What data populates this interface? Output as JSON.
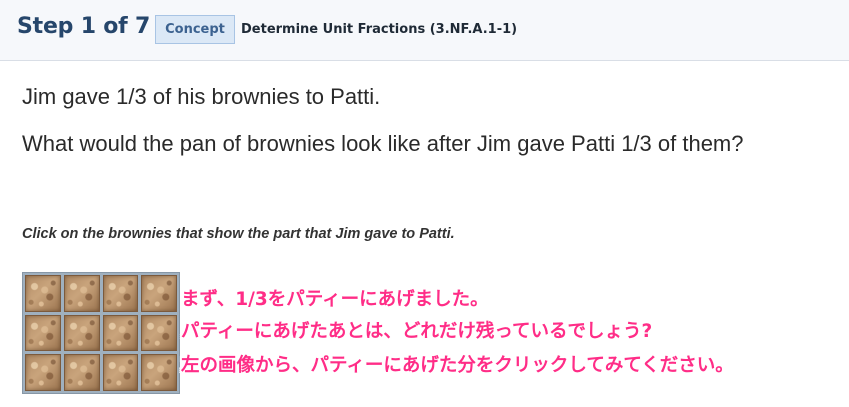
{
  "header": {
    "step_title": "Step 1 of 7",
    "badge_label": "Concept",
    "concept_name": "Determine Unit Fractions (3.NF.A.1-1)"
  },
  "problem": {
    "question1": "Jim gave 1/3 of his brownies to Patti.",
    "question2": "What would the pan of brownies look like after Jim gave Patti 1/3 of them?",
    "instruction": "Click on the brownies that show the part that Jim gave to Patti."
  },
  "brownie_grid": {
    "rows": 3,
    "cols": 4
  },
  "annotation": {
    "line1": "まず、1/3をパティーにあげました。",
    "line2": "パティーにあげたあとは、どれだけ残っているでしょう?",
    "line3": "左の画像から、パティーにあげた分をクリックしてみてください。",
    "color": "#ff2d87"
  }
}
